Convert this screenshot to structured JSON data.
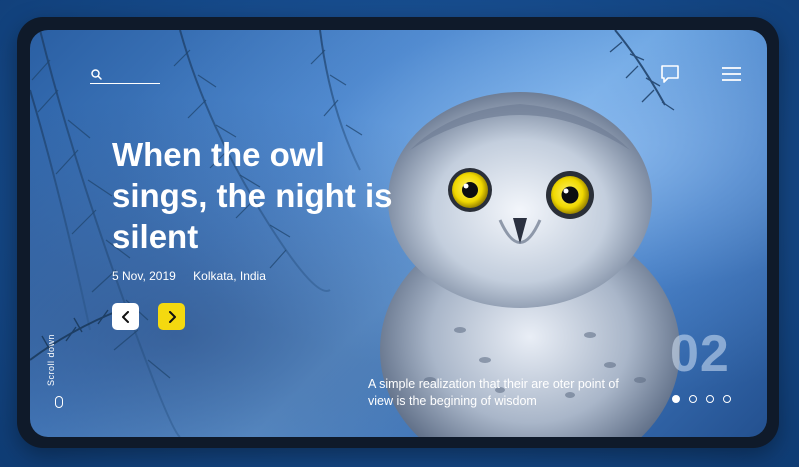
{
  "hero": {
    "title": "When the owl sings, the night is silent",
    "date": "5 Nov, 2019",
    "location": "Kolkata, India"
  },
  "scroll": {
    "label": "Scroll down"
  },
  "slider": {
    "number": "02",
    "caption": "A simple realization that their are oter point of view is the begining of wisdom",
    "total_dots": 4,
    "active_index": 0
  },
  "icons": {
    "search": "search-icon",
    "chat": "chat-icon",
    "menu": "menu-icon",
    "prev": "chevron-left-icon",
    "next": "chevron-right-icon",
    "mouse": "mouse-icon"
  },
  "colors": {
    "accent_yellow": "#f4d90f",
    "device_frame": "#0f1a2a",
    "background_blue": "#164a8a"
  }
}
